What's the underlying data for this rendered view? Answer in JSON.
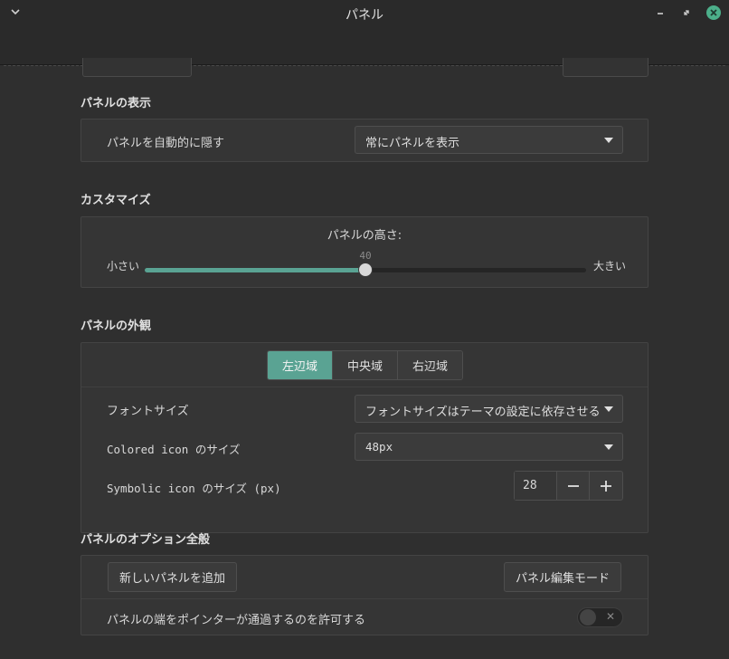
{
  "window": {
    "title": "パネル"
  },
  "sections": {
    "autohide": {
      "title": "パネルの表示",
      "label": "パネルを自動的に隠す",
      "value": "常にパネルを表示"
    },
    "customize": {
      "title": "カスタマイズ",
      "height_label": "パネルの高さ:",
      "min_label": "小さい",
      "max_label": "大きい",
      "height_value": "40",
      "height_fraction": 0.5
    },
    "appearance": {
      "title": "パネルの外観",
      "tabs": [
        "左辺域",
        "中央域",
        "右辺域"
      ],
      "active_tab": 0,
      "font_size_label": "フォントサイズ",
      "font_size_value": "フォントサイズはテーマの設定に依存させる",
      "colored_icon_label": "Colored icon のサイズ",
      "colored_icon_value": "48px",
      "symbolic_icon_label": "Symbolic icon のサイズ (px)",
      "symbolic_icon_value": "28"
    },
    "general": {
      "title": "パネルのオプション全般",
      "add_panel_label": "新しいパネルを追加",
      "edit_mode_label": "パネル編集モード",
      "pointer_label": "パネルの端をポインターが通過するのを許可する",
      "pointer_enabled": false
    }
  },
  "colors": {
    "accent": "#5aa393",
    "close_button": "#4caf8a"
  }
}
